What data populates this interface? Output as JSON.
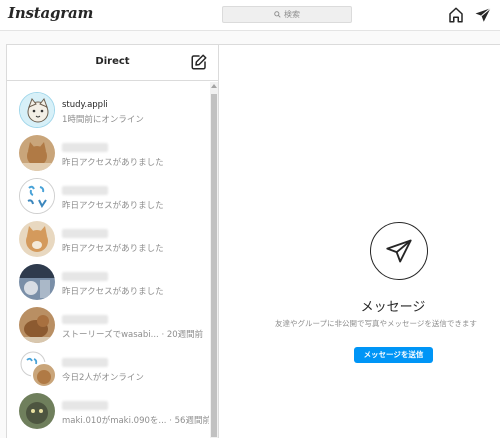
{
  "header": {
    "logo": "Instagram",
    "search_placeholder": "検索",
    "icons": [
      "home-icon",
      "direct-icon",
      "search-icon"
    ]
  },
  "direct": {
    "title": "Direct",
    "compose_icon": "compose-icon"
  },
  "conversations": [
    {
      "name": "study.appli",
      "status": "1時間前にオンライン",
      "name_visible": true
    },
    {
      "name": "",
      "status": "昨日アクセスがありました",
      "name_visible": false
    },
    {
      "name": "",
      "status": "昨日アクセスがありました",
      "name_visible": false
    },
    {
      "name": "",
      "status": "昨日アクセスがありました",
      "name_visible": false
    },
    {
      "name": "",
      "status": "昨日アクセスがありました",
      "name_visible": false
    },
    {
      "name": "",
      "status": "ストーリーズでwasabi...",
      "time": "20週間前",
      "name_visible": false
    },
    {
      "name": "",
      "status": "今日2人がオンライン",
      "name_visible": false
    },
    {
      "name": "",
      "status": "maki.010がmaki.090を...",
      "time": "56週間前",
      "name_visible": false
    }
  ],
  "main": {
    "title": "メッセージ",
    "description": "友達やグループに非公開で写真やメッセージを送信できます",
    "button": "メッセージを送信"
  },
  "colors": {
    "accent": "#0095f6",
    "border": "#dbdbdb",
    "muted_text": "#8e8e8e",
    "text": "#262626"
  }
}
